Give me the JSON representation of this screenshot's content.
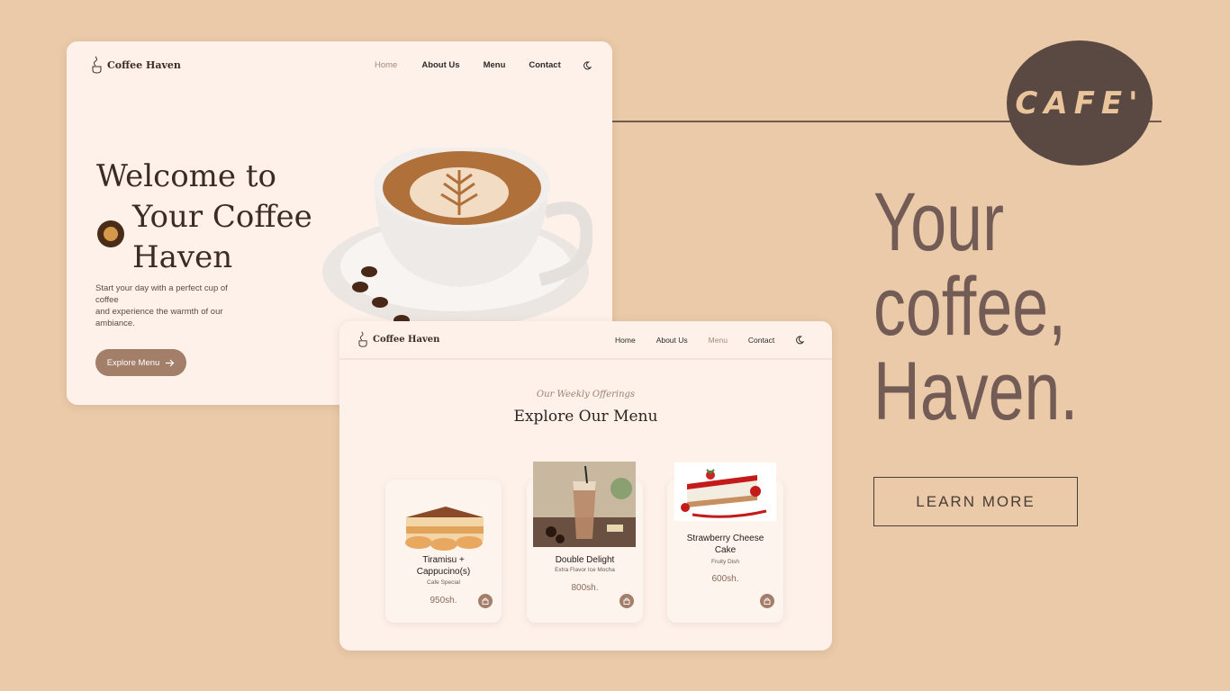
{
  "hero_page": {
    "brand": "Coffee Haven",
    "nav": [
      "Home",
      "About Us",
      "Menu",
      "Contact"
    ],
    "active_nav": "Home",
    "title_lines": [
      "Welcome to",
      "Your Coffee",
      "Haven"
    ],
    "description_lines": [
      "Start your day with a perfect cup of",
      "coffee",
      "and experience the warmth of our",
      "ambiance."
    ],
    "cta_label": "Explore Menu"
  },
  "menu_page": {
    "brand": "Coffee Haven",
    "nav": [
      "Home",
      "About Us",
      "Menu",
      "Contact"
    ],
    "active_nav": "Menu",
    "eyebrow": "Our Weekly Offerings",
    "title": "Explore Our Menu",
    "items": [
      {
        "name_lines": [
          "Tiramisu +",
          "Cappucino(s)"
        ],
        "subtitle": "Cafe Special",
        "price": "950sh."
      },
      {
        "name_lines": [
          "Double Delight"
        ],
        "subtitle": "Extra Flavor Ice Mocha",
        "price": "800sh."
      },
      {
        "name_lines": [
          "Strawberry Cheese",
          "Cake"
        ],
        "subtitle": "Fruity Dish",
        "price": "600sh."
      }
    ]
  },
  "promo": {
    "badge": "CAFE'",
    "headline_lines": [
      "Your",
      "coffee,",
      "Haven."
    ],
    "button_label": "LEARN MORE"
  },
  "colors": {
    "background": "#eacaa8",
    "card": "#fdf1ea",
    "accent": "#a37e69",
    "badge": "#5a4842",
    "headline": "#735c56"
  }
}
